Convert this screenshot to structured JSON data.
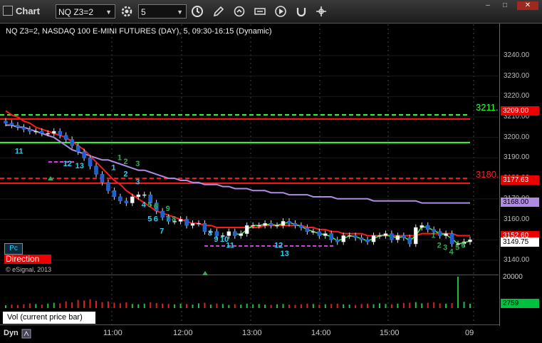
{
  "window": {
    "title": "Chart",
    "symbol": "NQ Z3=2",
    "interval": "5"
  },
  "chart": {
    "title": "NQ Z3=2, NASDAQ 100 E-MINI FUTURES (DAY), 5, 09:30-16:15 (Dynamic)",
    "copyright": "© eSignal, 2013",
    "pc_label": "Pc",
    "direction_label": "Direction",
    "volume_label": "Vol (current price bar)",
    "dyn_label": "Dyn",
    "level_labels": {
      "upper": "3211.",
      "mid": "3180."
    },
    "price_tags": {
      "red_high": "3209.00",
      "red_mid": "3177.63",
      "purple": "3168.00",
      "red_low": "3152.60",
      "last": "3149.75",
      "volume": "2759",
      "volume_axis": "20000"
    },
    "colors": {
      "background": "#000000",
      "red": "#ff1a1a",
      "green": "#33ff33",
      "purple": "#b08ce0",
      "magenta": "#e040e0",
      "cyan": "#33ccee",
      "seq_green": "#33aa55"
    }
  },
  "chart_data": {
    "type": "candlestick",
    "y_unit": "price",
    "ylim": [
      3133,
      3248
    ],
    "y_ticks": [
      3140,
      3150,
      3160,
      3170,
      3180,
      3190,
      3200,
      3210,
      3220,
      3230,
      3240
    ],
    "y_tick_labels": [
      "3140.00",
      "3150.00",
      "3160.00",
      "3170.00",
      "3180.00",
      "3190.00",
      "3200.00",
      "3210.00",
      "3220.00",
      "3230.00",
      "3240.00"
    ],
    "x_labels": [
      "11:00",
      "12:00",
      "13:00",
      "14:00",
      "15:00",
      "09"
    ],
    "horizontal_levels": [
      {
        "value": 3211,
        "color": "green",
        "style": "dashed"
      },
      {
        "value": 3209,
        "color": "red",
        "style": "solid"
      },
      {
        "value": 3197.5,
        "color": "green",
        "style": "solid"
      },
      {
        "value": 3180,
        "color": "red",
        "style": "dashed"
      },
      {
        "value": 3177.63,
        "color": "red",
        "style": "solid"
      }
    ],
    "closes": [
      3207,
      3206,
      3205,
      3204,
      3203,
      3203,
      3202,
      3202,
      3203,
      3201,
      3199,
      3196,
      3193,
      3190,
      3186,
      3182,
      3178,
      3174,
      3171,
      3169,
      3168,
      3171,
      3172,
      3172,
      3168,
      3164,
      3161,
      3159,
      3159,
      3160,
      3157,
      3158,
      3158,
      3154,
      3154,
      3152,
      3152,
      3154,
      3152,
      3153,
      3157,
      3157,
      3157,
      3158,
      3157,
      3157,
      3159,
      3158,
      3157,
      3156,
      3154,
      3154,
      3152,
      3153,
      3150,
      3149,
      3152,
      3152,
      3151,
      3150,
      3149,
      3152,
      3152,
      3153,
      3150,
      3152,
      3151,
      3148,
      3156,
      3157,
      3155,
      3154,
      3152,
      3153,
      3148,
      3148,
      3149,
      3150
    ],
    "moving_average_red": [
      3213,
      3211,
      3210,
      3208,
      3207,
      3205,
      3204,
      3203,
      3202,
      3201,
      3200,
      3198,
      3196,
      3194,
      3191,
      3188,
      3185,
      3182,
      3179,
      3177,
      3174,
      3172,
      3170,
      3168,
      3166,
      3164,
      3163,
      3162,
      3161,
      3160,
      3159,
      3158,
      3158,
      3157,
      3157,
      3156,
      3156,
      3156,
      3156,
      3156,
      3156,
      3156,
      3156,
      3157,
      3157,
      3157,
      3157,
      3157,
      3157,
      3157,
      3156,
      3156,
      3155,
      3155,
      3154,
      3154,
      3153,
      3153,
      3153,
      3153,
      3152,
      3152,
      3152,
      3152,
      3152,
      3152,
      3152,
      3152,
      3152,
      3153,
      3153,
      3153,
      3153,
      3153,
      3153,
      3152,
      3152,
      3152
    ],
    "moving_average_purple": [
      3206,
      3206,
      3205,
      3205,
      3204,
      3203,
      3202,
      3201,
      3200,
      3198,
      3196,
      3194,
      3193,
      3192,
      3191,
      3190,
      3189,
      3189,
      3188,
      3187,
      3186,
      3185,
      3184,
      3184,
      3183,
      3182,
      3181,
      3180,
      3180,
      3179,
      3179,
      3178,
      3178,
      3177,
      3177,
      3177,
      3176,
      3176,
      3175,
      3175,
      3175,
      3174,
      3174,
      3174,
      3173,
      3173,
      3173,
      3172,
      3172,
      3172,
      3172,
      3171,
      3171,
      3171,
      3171,
      3170,
      3170,
      3170,
      3170,
      3170,
      3170,
      3169,
      3169,
      3169,
      3169,
      3169,
      3169,
      3169,
      3169,
      3168,
      3168,
      3168,
      3168,
      3168,
      3168,
      3168,
      3168,
      3168
    ],
    "volume": [
      1800,
      2200,
      2000,
      2400,
      3000,
      2600,
      2200,
      2800,
      3400,
      3000,
      4200,
      3600,
      5200,
      4800,
      5600,
      4600,
      3800,
      4200,
      3400,
      3000,
      3600,
      2600,
      2400,
      2800,
      3600,
      3200,
      2800,
      2600,
      2400,
      2800,
      2600,
      2200,
      3000,
      3400,
      2200,
      2800,
      2600,
      2000,
      2400,
      2200,
      2800,
      2400,
      2600,
      2200,
      2000,
      2400,
      2600,
      2200,
      2000,
      2400,
      2800,
      2600,
      2200,
      2400,
      2600,
      2800,
      2400,
      2200,
      2000,
      2600,
      2800,
      2400,
      3000,
      2600,
      2400,
      2800,
      3200,
      3400,
      3800,
      3000,
      3400,
      3600,
      3000,
      2800,
      3200,
      20000,
      4000,
      2759
    ],
    "sequence_labels": [
      {
        "text": "11",
        "bar": 2,
        "price": 3192,
        "color": "cyan"
      },
      {
        "text": "12",
        "bar": 10,
        "price": 3186,
        "color": "cyan"
      },
      {
        "text": "13",
        "bar": 12,
        "price": 3185,
        "color": "cyan"
      },
      {
        "text": "1",
        "bar": 19,
        "price": 3189,
        "color": "seq_green"
      },
      {
        "text": "2",
        "bar": 20,
        "price": 3187,
        "color": "seq_green"
      },
      {
        "text": "3",
        "bar": 22,
        "price": 3186,
        "color": "seq_green"
      },
      {
        "text": "1",
        "bar": 18,
        "price": 3184,
        "color": "cyan"
      },
      {
        "text": "2",
        "bar": 20,
        "price": 3181,
        "color": "cyan"
      },
      {
        "text": "3",
        "bar": 22,
        "price": 3177,
        "color": "cyan"
      },
      {
        "text": "4",
        "bar": 23,
        "price": 3166,
        "color": "cyan"
      },
      {
        "text": "5",
        "bar": 24,
        "price": 3166,
        "color": "seq_green"
      },
      {
        "text": "6",
        "bar": 25,
        "price": 3165,
        "color": "seq_green"
      },
      {
        "text": "9",
        "bar": 27,
        "price": 3164,
        "color": "seq_green"
      },
      {
        "text": "5",
        "bar": 24,
        "price": 3159,
        "color": "cyan"
      },
      {
        "text": "6",
        "bar": 25,
        "price": 3159,
        "color": "cyan"
      },
      {
        "text": "7",
        "bar": 27,
        "price": 3159,
        "color": "seq_green"
      },
      {
        "text": "8",
        "bar": 28,
        "price": 3159,
        "color": "seq_green"
      },
      {
        "text": "7",
        "bar": 26,
        "price": 3153,
        "color": "cyan"
      },
      {
        "text": "8",
        "bar": 34,
        "price": 3152,
        "color": "cyan"
      },
      {
        "text": "9",
        "bar": 35,
        "price": 3149,
        "color": "cyan"
      },
      {
        "text": "10",
        "bar": 36,
        "price": 3149,
        "color": "cyan"
      },
      {
        "text": "11",
        "bar": 37,
        "price": 3146,
        "color": "cyan"
      },
      {
        "text": "12",
        "bar": 45,
        "price": 3146,
        "color": "cyan"
      },
      {
        "text": "13",
        "bar": 46,
        "price": 3142,
        "color": "cyan"
      },
      {
        "text": "1",
        "bar": 71,
        "price": 3151,
        "color": "seq_green"
      },
      {
        "text": "2",
        "bar": 72,
        "price": 3146,
        "color": "seq_green"
      },
      {
        "text": "3",
        "bar": 73,
        "price": 3145,
        "color": "seq_green"
      },
      {
        "text": "4",
        "bar": 74,
        "price": 3143,
        "color": "seq_green"
      },
      {
        "text": "5",
        "bar": 75,
        "price": 3145,
        "color": "seq_green"
      },
      {
        "text": "6",
        "bar": 76,
        "price": 3146,
        "color": "seq_green"
      }
    ]
  }
}
